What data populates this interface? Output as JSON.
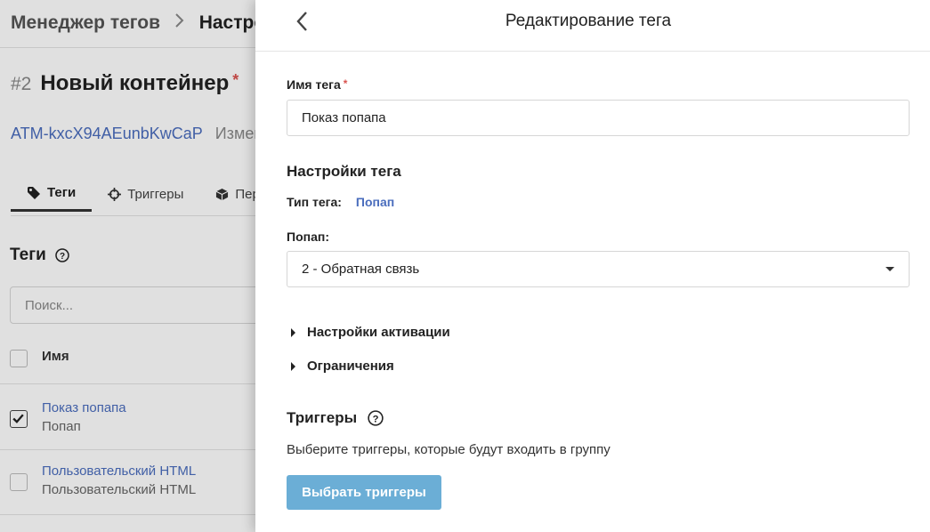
{
  "background": {
    "breadcrumb": {
      "root": "Менеджер тегов",
      "current": "Настрой"
    },
    "container": {
      "number": "#2",
      "name": "Новый контейнер",
      "required_mark": "*",
      "id": "ATM-kxcX94AEunbKwCaP",
      "changed": "Измен"
    },
    "tabs": [
      {
        "label": "Теги",
        "icon": "tag-icon",
        "active": true
      },
      {
        "label": "Триггеры",
        "icon": "crosshair-icon"
      },
      {
        "label": "Пер",
        "icon": "cube-icon"
      }
    ],
    "tags_section": {
      "title": "Теги",
      "search_placeholder": "Поиск..."
    },
    "table": {
      "header": "Имя",
      "rows": [
        {
          "name": "Показ попапа",
          "type": "Попап",
          "checked": true
        },
        {
          "name": "Пользовательский HTML",
          "type": "Пользовательский HTML",
          "checked": false
        }
      ]
    }
  },
  "drawer": {
    "title": "Редактирование тега",
    "tag_name_label": "Имя тега",
    "required_mark": "*",
    "tag_name_value": "Показ попапа",
    "settings_title": "Настройки тега",
    "tag_type_label": "Тип тега:",
    "tag_type_value": "Попап",
    "popup_label": "Попап:",
    "popup_selected": "2 - Обратная связь",
    "activation_settings": "Настройки активации",
    "restrictions": "Ограничения",
    "triggers_title": "Триггеры",
    "triggers_description": "Выберите триггеры, которые будут входить в группу",
    "choose_triggers_button": "Выбрать триггеры"
  },
  "colors": {
    "link": "#4a6dbd",
    "primary_button": "#6baed6",
    "required": "#d9534f"
  }
}
